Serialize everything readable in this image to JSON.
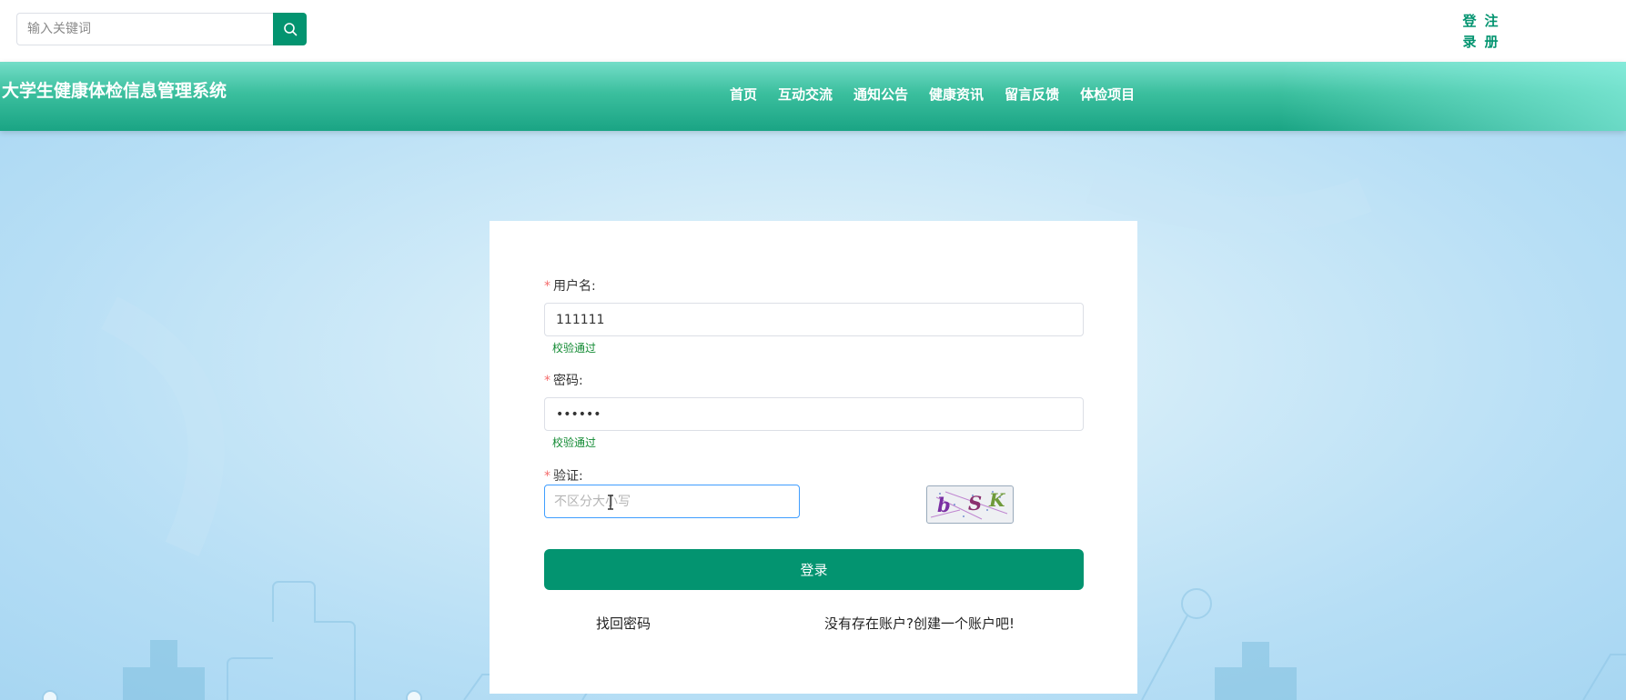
{
  "search": {
    "placeholder": "输入关键词"
  },
  "auth": {
    "login_chars": [
      "登",
      "录"
    ],
    "register_chars": [
      "注",
      "册"
    ]
  },
  "header": {
    "site_title": "大学生健康体检信息管理系统",
    "nav": [
      "首页",
      "互动交流",
      "通知公告",
      "健康资讯",
      "留言反馈",
      "体检项目"
    ]
  },
  "form": {
    "username_label": "用户名:",
    "username_value": "111111",
    "username_status": "校验通过",
    "password_label": "密码:",
    "password_value": "••••••",
    "password_status": "校验通过",
    "captcha_label": "验证:",
    "captcha_placeholder": "不区分大小写",
    "captcha_chars": [
      "b",
      "S",
      "K"
    ],
    "login_button": "登录",
    "forgot_link": "找回密码",
    "register_link": "没有存在账户?创建一个账户吧!"
  },
  "colors": {
    "accent": "#039470",
    "header": "#3bbf9e",
    "required": "#f56c6c",
    "success": "#118a32",
    "focus": "#409eff"
  }
}
